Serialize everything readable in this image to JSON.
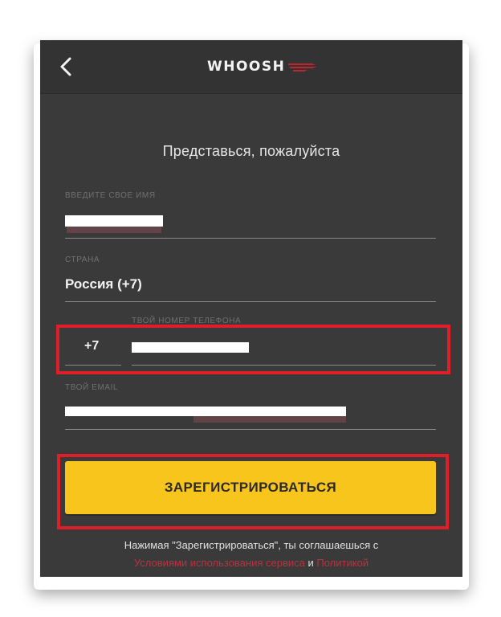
{
  "header": {
    "logo_text": "WHOOSH",
    "back_icon": "chevron-left-icon"
  },
  "form": {
    "heading": "Представься, пожалуйста",
    "name_label": "введите свое имя",
    "name_value": "",
    "country_label": "страна",
    "country_value": "Россия (+7)",
    "phone_label": "твой номер телефона",
    "phone_code": "+7",
    "phone_value": "",
    "email_label": "твой email",
    "email_value": "",
    "register_label": "ЗАРЕГИСТРИРОВАТЬСЯ"
  },
  "terms": {
    "prefix": "Нажимая \"Зарегистрироваться\", ты соглашаешься с",
    "terms_link": "Условиями использования сервиса",
    "and": "и",
    "policy_link": "Политикой"
  },
  "colors": {
    "background": "#3a3a3a",
    "accent_yellow": "#f7c51b",
    "highlight_red": "#e01e2a",
    "link_red": "#b8323c"
  }
}
